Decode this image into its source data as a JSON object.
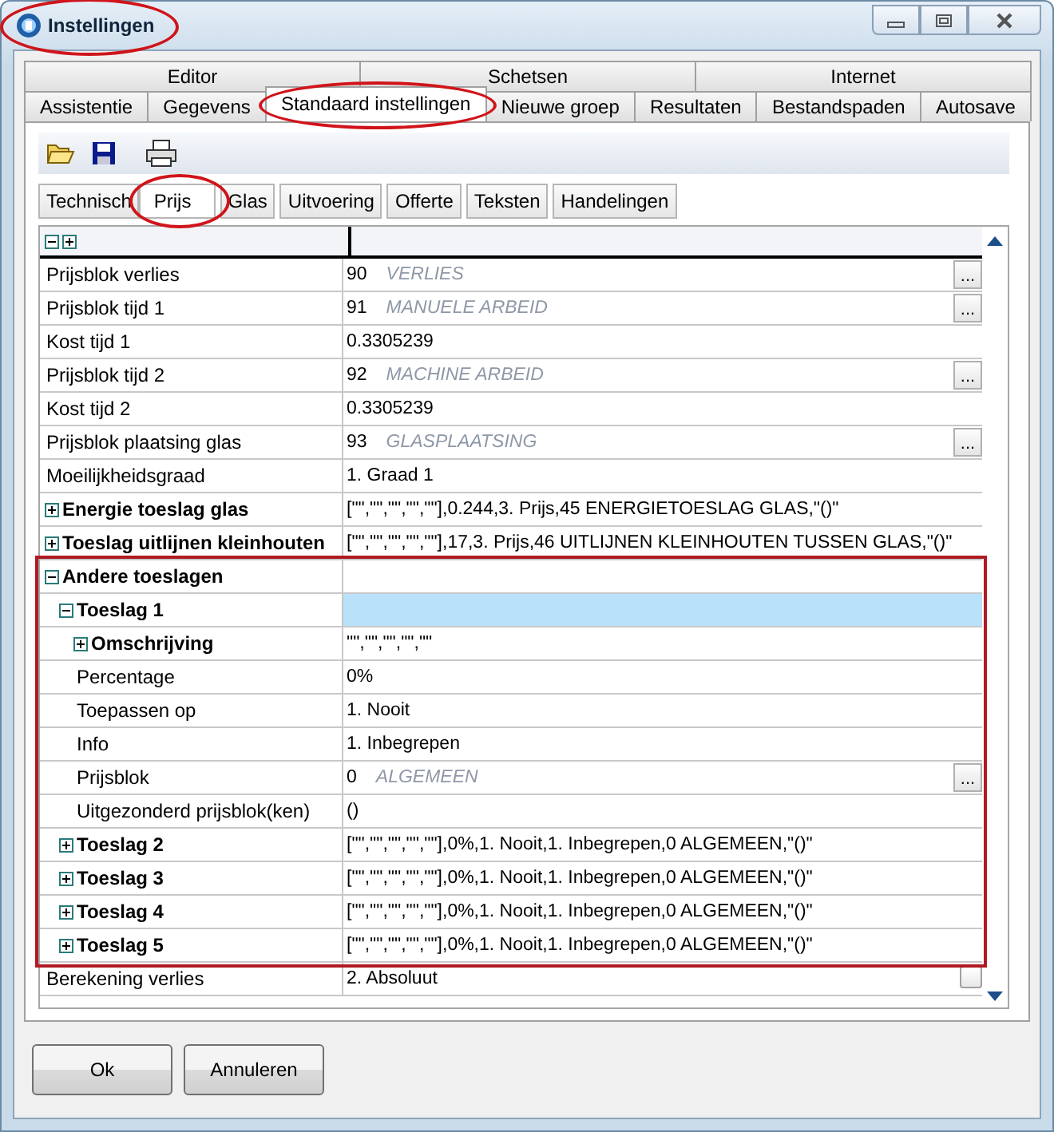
{
  "window": {
    "title": "Instellingen",
    "circled": true
  },
  "tab_rows": [
    [
      {
        "label": "Editor",
        "selected": false
      },
      {
        "label": "Schetsen",
        "selected": false
      },
      {
        "label": "Internet",
        "selected": false
      }
    ],
    [
      {
        "label": "Assistentie",
        "selected": false
      },
      {
        "label": "Gegevens",
        "selected": false
      },
      {
        "label": "Standaard instellingen",
        "selected": true,
        "circled": true
      },
      {
        "label": "Nieuwe groep",
        "selected": false
      },
      {
        "label": "Resultaten",
        "selected": false
      },
      {
        "label": "Bestandspaden",
        "selected": false
      },
      {
        "label": "Autosave",
        "selected": false
      }
    ]
  ],
  "subtabs": [
    {
      "label": "Technisch",
      "selected": false
    },
    {
      "label": "Prijs",
      "selected": true,
      "circled": true
    },
    {
      "label": "Glas",
      "selected": false
    },
    {
      "label": "Uitvoering",
      "selected": false
    },
    {
      "label": "Offerte",
      "selected": false
    },
    {
      "label": "Teksten",
      "selected": false
    },
    {
      "label": "Handelingen",
      "selected": false
    }
  ],
  "grid": {
    "rows": [
      {
        "label": "Prijsblok verlies",
        "value": "90",
        "hint": "VERLIES",
        "button": "...",
        "selected": false
      },
      {
        "label": "Prijsblok tijd 1",
        "value": "91",
        "hint": "MANUELE ARBEID",
        "button": "...",
        "selected": false
      },
      {
        "label": "Kost tijd 1",
        "value": "0.3305239",
        "selected": false
      },
      {
        "label": "Prijsblok tijd 2",
        "value": "92",
        "hint": "MACHINE ARBEID",
        "button": "...",
        "selected": false
      },
      {
        "label": "Kost tijd 2",
        "value": "0.3305239",
        "selected": false
      },
      {
        "label": "Prijsblok plaatsing glas",
        "value": "93",
        "hint": "GLASPLAATSING",
        "button": "...",
        "selected": false
      },
      {
        "label": "Moeilijkheidsgraad",
        "value": "1. Graad 1",
        "selected": false
      },
      {
        "label": "Energie toeslag glas",
        "value": "[\"\",\"\",\"\",\"\",\"\"],0.244,3. Prijs,45 ENERGIETOESLAG GLAS,\"()\"",
        "expanded": false,
        "selected": false
      },
      {
        "label": "Toeslag uitlijnen kleinhouten",
        "value": "[\"\",\"\",\"\",\"\",\"\"],17,3. Prijs,46 UITLIJNEN KLEINHOUTEN TUSSEN GLAS,\"()\"",
        "expanded": false,
        "selected": false
      },
      {
        "label": "Andere toeslagen",
        "expanded": true,
        "selected": false,
        "outlined": true,
        "children": [
          {
            "label": "Toeslag 1",
            "expanded": true,
            "selected": true,
            "children": [
              {
                "label": "Omschrijving",
                "value": "\"\",\"\",\"\",\"\",\"\"",
                "expanded": false,
                "selected": false
              },
              {
                "label": "Percentage",
                "value": "0%",
                "selected": false
              },
              {
                "label": "Toepassen op",
                "value": "1. Nooit",
                "selected": false
              },
              {
                "label": "Info",
                "value": "1. Inbegrepen",
                "selected": false
              },
              {
                "label": "Prijsblok",
                "value": "0",
                "hint": "ALGEMEEN",
                "button": "...",
                "selected": false
              },
              {
                "label": "Uitgezonderd prijsblok(ken)",
                "value": "()",
                "selected": false
              }
            ]
          },
          {
            "label": "Toeslag 2",
            "value": "[\"\",\"\",\"\",\"\",\"\"],0%,1. Nooit,1. Inbegrepen,0 ALGEMEEN,\"()\"",
            "expanded": false,
            "selected": false
          },
          {
            "label": "Toeslag 3",
            "value": "[\"\",\"\",\"\",\"\",\"\"],0%,1. Nooit,1. Inbegrepen,0 ALGEMEEN,\"()\"",
            "expanded": false,
            "selected": false
          },
          {
            "label": "Toeslag 4",
            "value": "[\"\",\"\",\"\",\"\",\"\"],0%,1. Nooit,1. Inbegrepen,0 ALGEMEEN,\"()\"",
            "expanded": false,
            "selected": false
          },
          {
            "label": "Toeslag 5",
            "value": "[\"\",\"\",\"\",\"\",\"\"],0%,1. Nooit,1. Inbegrepen,0 ALGEMEEN,\"()\"",
            "expanded": false,
            "selected": false
          }
        ]
      },
      {
        "label": "Berekening verlies",
        "value": "2. Absoluut",
        "kind": "checkbox",
        "checked": false,
        "selected": false
      }
    ]
  },
  "buttons": [
    {
      "label": "Ok"
    },
    {
      "label": "Annuleren"
    }
  ]
}
